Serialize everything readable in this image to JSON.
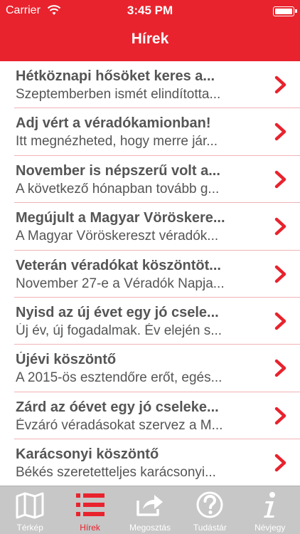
{
  "status_bar": {
    "carrier": "Carrier",
    "time": "3:45 PM"
  },
  "nav": {
    "title": "Hírek"
  },
  "accent_color": "#e8232d",
  "news": [
    {
      "title": "Hétköznapi hősöket keres a...",
      "subtitle": "Szeptemberben ismét elindította..."
    },
    {
      "title": "Adj vért a véradókamionban!",
      "subtitle": "Itt megnézheted, hogy merre jár..."
    },
    {
      "title": "November is népszerű volt a...",
      "subtitle": "A következő hónapban tovább g..."
    },
    {
      "title": "Megújult a Magyar Vöröskere...",
      "subtitle": "A Magyar Vöröskereszt véradók..."
    },
    {
      "title": "Veterán véradókat köszöntöt...",
      "subtitle": "November 27-e a Véradók Napja..."
    },
    {
      "title": "Nyisd az új évet egy jó csele...",
      "subtitle": "Új év, új fogadalmak. Év elején s..."
    },
    {
      "title": "Újévi köszöntő",
      "subtitle": "A 2015-ös esztendőre erőt, egés..."
    },
    {
      "title": "Zárd az óévet egy jó cseleke...",
      "subtitle": "Évzáró véradásokat szervez a M..."
    },
    {
      "title": "Karácsonyi köszöntő",
      "subtitle": "Békés szeretetteljes karácsonyi..."
    }
  ],
  "tabs": [
    {
      "label": "Térkép",
      "icon": "map-icon",
      "active": false
    },
    {
      "label": "Hírek",
      "icon": "list-icon",
      "active": true
    },
    {
      "label": "Megosztás",
      "icon": "share-icon",
      "active": false
    },
    {
      "label": "Tudástár",
      "icon": "question-icon",
      "active": false
    },
    {
      "label": "Névjegy",
      "icon": "info-icon",
      "active": false
    }
  ]
}
